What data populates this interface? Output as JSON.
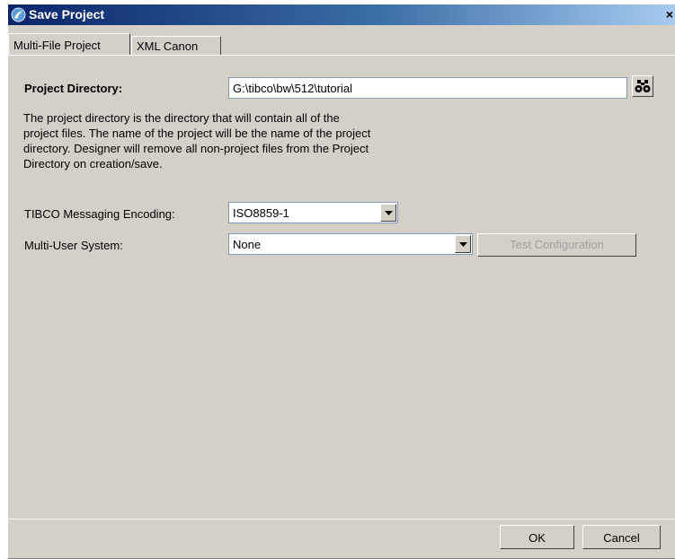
{
  "window": {
    "title": "Save Project",
    "close_glyph": "×",
    "icon": "tibco-logo-icon"
  },
  "tabs": [
    {
      "label": "Multi-File Project",
      "active": true
    },
    {
      "label": "XML Canon",
      "active": false
    }
  ],
  "form": {
    "project_directory_label": "Project Directory:",
    "project_directory_value": "G:\\tibco\\bw\\512\\tutorial",
    "browse_icon": "binoculars-icon",
    "description": "The project directory is the directory that will contain all of the\nproject files. The name of the project will be the name of the project\ndirectory. Designer will remove all non-project files from the Project\nDirectory on creation/save.",
    "encoding_label": "TIBCO Messaging Encoding:",
    "encoding_value": "ISO8859-1",
    "multiuser_label": "Multi-User System:",
    "multiuser_value": "None",
    "test_config_label": "Test Configuration"
  },
  "buttons": {
    "ok_label": "OK",
    "cancel_label": "Cancel"
  },
  "colors": {
    "dialog_bg": "#d4d0c8",
    "title_start": "#0a246a",
    "title_end": "#a6caf0",
    "disabled_text": "#a0a0a0"
  }
}
